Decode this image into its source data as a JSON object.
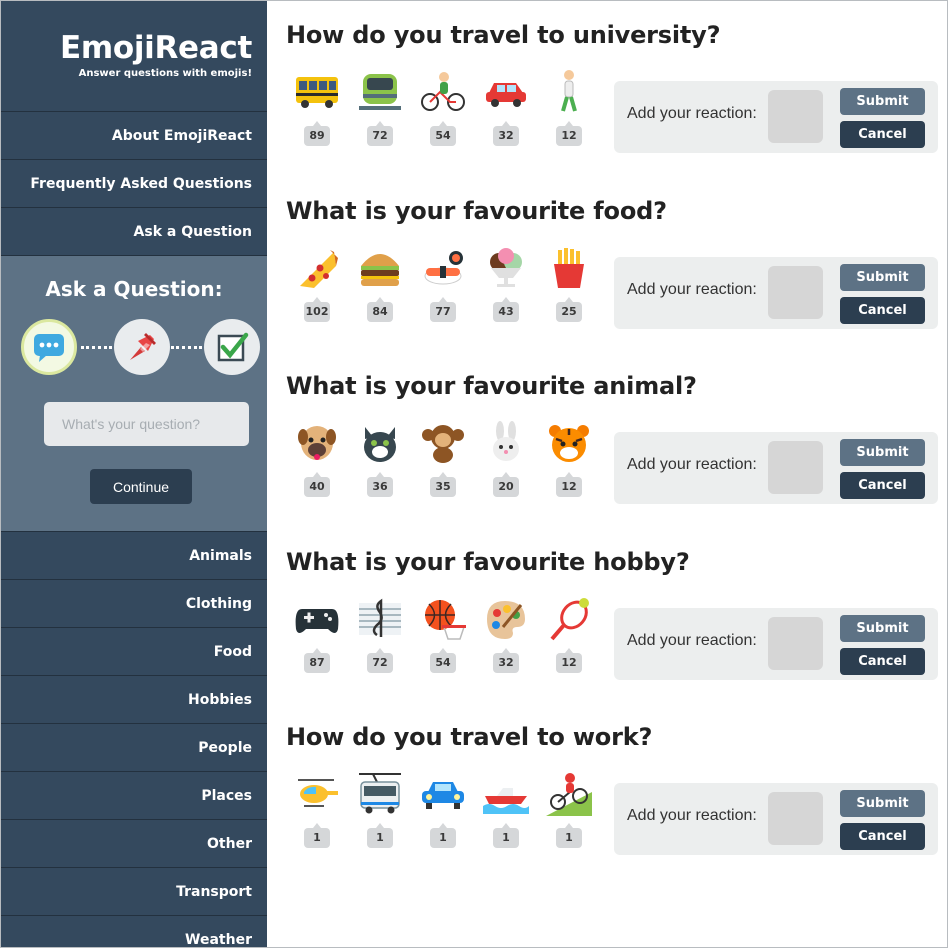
{
  "brand": {
    "title": "EmojiReact",
    "tagline": "Answer questions with emojis!"
  },
  "nav_top": [
    {
      "label": "About EmojiReact"
    },
    {
      "label": "Frequently Asked Questions"
    },
    {
      "label": "Ask a Question"
    }
  ],
  "ask": {
    "title": "Ask a Question:",
    "steps": [
      "speech-bubble-icon",
      "pin-icon",
      "checkbox-icon"
    ],
    "input_placeholder": "What's your question?",
    "continue_label": "Continue"
  },
  "categories": [
    {
      "label": "Animals"
    },
    {
      "label": "Clothing"
    },
    {
      "label": "Food"
    },
    {
      "label": "Hobbies"
    },
    {
      "label": "People"
    },
    {
      "label": "Places"
    },
    {
      "label": "Other"
    },
    {
      "label": "Transport"
    },
    {
      "label": "Weather"
    }
  ],
  "reaction": {
    "label": "Add your reaction:",
    "submit": "Submit",
    "cancel": "Cancel"
  },
  "questions": [
    {
      "title": "How do you travel to university?",
      "emojis": [
        {
          "icon": "bus-icon",
          "glyph": "🚌",
          "count": "89"
        },
        {
          "icon": "tram-icon",
          "glyph": "🚊",
          "count": "72"
        },
        {
          "icon": "cyclist-icon",
          "glyph": "🚴",
          "count": "54"
        },
        {
          "icon": "car-icon",
          "glyph": "🚗",
          "count": "32"
        },
        {
          "icon": "walking-icon",
          "glyph": "🚶",
          "count": "12"
        }
      ]
    },
    {
      "title": "What is your favourite food?",
      "emojis": [
        {
          "icon": "pizza-icon",
          "glyph": "🍕",
          "count": "102"
        },
        {
          "icon": "burger-icon",
          "glyph": "🍔",
          "count": "84"
        },
        {
          "icon": "sushi-icon",
          "glyph": "🍣",
          "count": "77"
        },
        {
          "icon": "ice-cream-icon",
          "glyph": "🍨",
          "count": "43"
        },
        {
          "icon": "fries-icon",
          "glyph": "🍟",
          "count": "25"
        }
      ]
    },
    {
      "title": "What is your favourite animal?",
      "emojis": [
        {
          "icon": "dog-icon",
          "glyph": "🐶",
          "count": "40"
        },
        {
          "icon": "cat-icon",
          "glyph": "🐱",
          "count": "36"
        },
        {
          "icon": "monkey-icon",
          "glyph": "🐒",
          "count": "35"
        },
        {
          "icon": "rabbit-icon",
          "glyph": "🐰",
          "count": "20"
        },
        {
          "icon": "tiger-icon",
          "glyph": "🐯",
          "count": "12"
        }
      ]
    },
    {
      "title": "What is your favourite hobby?",
      "emojis": [
        {
          "icon": "gamepad-icon",
          "glyph": "🎮",
          "count": "87"
        },
        {
          "icon": "music-icon",
          "glyph": "🎼",
          "count": "72"
        },
        {
          "icon": "basketball-icon",
          "glyph": "🏀",
          "count": "54"
        },
        {
          "icon": "palette-icon",
          "glyph": "🎨",
          "count": "32"
        },
        {
          "icon": "tennis-icon",
          "glyph": "🎾",
          "count": "12"
        }
      ]
    },
    {
      "title": "How do you travel to work?",
      "emojis": [
        {
          "icon": "helicopter-icon",
          "glyph": "🚁",
          "count": "1"
        },
        {
          "icon": "trolleybus-icon",
          "glyph": "🚎",
          "count": "1"
        },
        {
          "icon": "car-icon",
          "glyph": "🚙",
          "count": "1"
        },
        {
          "icon": "speedboat-icon",
          "glyph": "🚤",
          "count": "1"
        },
        {
          "icon": "mountain-bike-icon",
          "glyph": "🚵",
          "count": "1"
        }
      ]
    }
  ],
  "colors": {
    "sidebar": "#34495e",
    "ask_panel": "#5d7285",
    "button_dark": "#2c3e50",
    "button_light": "#5d7285",
    "count_badge": "#d5d7d9",
    "reaction_box": "#eceeee"
  }
}
